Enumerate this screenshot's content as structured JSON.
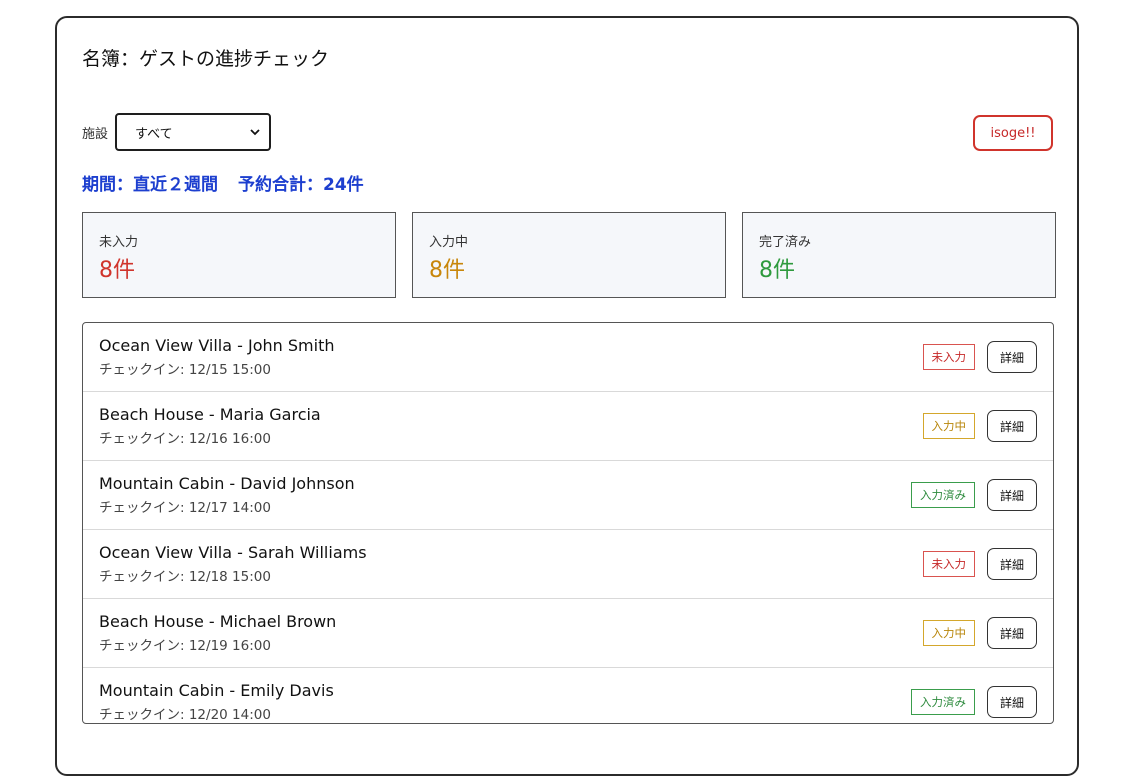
{
  "title": "名簿：ゲストの進捗チェック",
  "filter": {
    "label": "施設",
    "selected": "すべて"
  },
  "isoge_label": "isoge!!",
  "period": {
    "range": "期間：直近２週間",
    "total": "予約合計：24件"
  },
  "stats": [
    {
      "label": "未入力",
      "value": "8件",
      "color": "#d0342c"
    },
    {
      "label": "入力中",
      "value": "8件",
      "color": "#c8860a"
    },
    {
      "label": "完了済み",
      "value": "8件",
      "color": "#2e9a3d"
    }
  ],
  "detail_label": "詳細",
  "rows": [
    {
      "name": "Ocean View Villa - John Smith",
      "checkin": "チェックイン: 12/15 15:00",
      "status": "未入力",
      "tone": "red"
    },
    {
      "name": "Beach House - Maria Garcia",
      "checkin": "チェックイン: 12/16 16:00",
      "status": "入力中",
      "tone": "amber"
    },
    {
      "name": "Mountain Cabin - David Johnson",
      "checkin": "チェックイン: 12/17 14:00",
      "status": "入力済み",
      "tone": "green"
    },
    {
      "name": "Ocean View Villa - Sarah Williams",
      "checkin": "チェックイン: 12/18 15:00",
      "status": "未入力",
      "tone": "red"
    },
    {
      "name": "Beach House - Michael Brown",
      "checkin": "チェックイン: 12/19 16:00",
      "status": "入力中",
      "tone": "amber"
    },
    {
      "name": "Mountain Cabin - Emily Davis",
      "checkin": "チェックイン: 12/20 14:00",
      "status": "入力済み",
      "tone": "green"
    }
  ]
}
